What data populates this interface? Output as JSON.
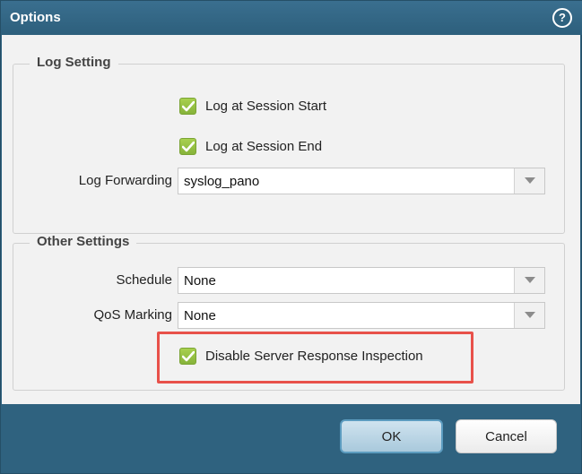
{
  "dialog": {
    "title": "Options",
    "help_icon": "help-question-icon"
  },
  "log_setting": {
    "legend": "Log Setting",
    "log_start": {
      "label": "Log at Session Start",
      "checked": true
    },
    "log_end": {
      "label": "Log at Session End",
      "checked": true
    },
    "log_forwarding": {
      "label": "Log Forwarding",
      "value": "syslog_pano"
    }
  },
  "other_settings": {
    "legend": "Other Settings",
    "schedule": {
      "label": "Schedule",
      "value": "None"
    },
    "qos": {
      "label": "QoS Marking",
      "value": "None"
    },
    "disable_inspection": {
      "label": "Disable Server Response Inspection",
      "checked": true
    }
  },
  "buttons": {
    "ok": "OK",
    "cancel": "Cancel"
  },
  "colors": {
    "titlebar": "#2f627f",
    "checkbox": "#8fbf3f",
    "highlight": "#e8514a"
  }
}
